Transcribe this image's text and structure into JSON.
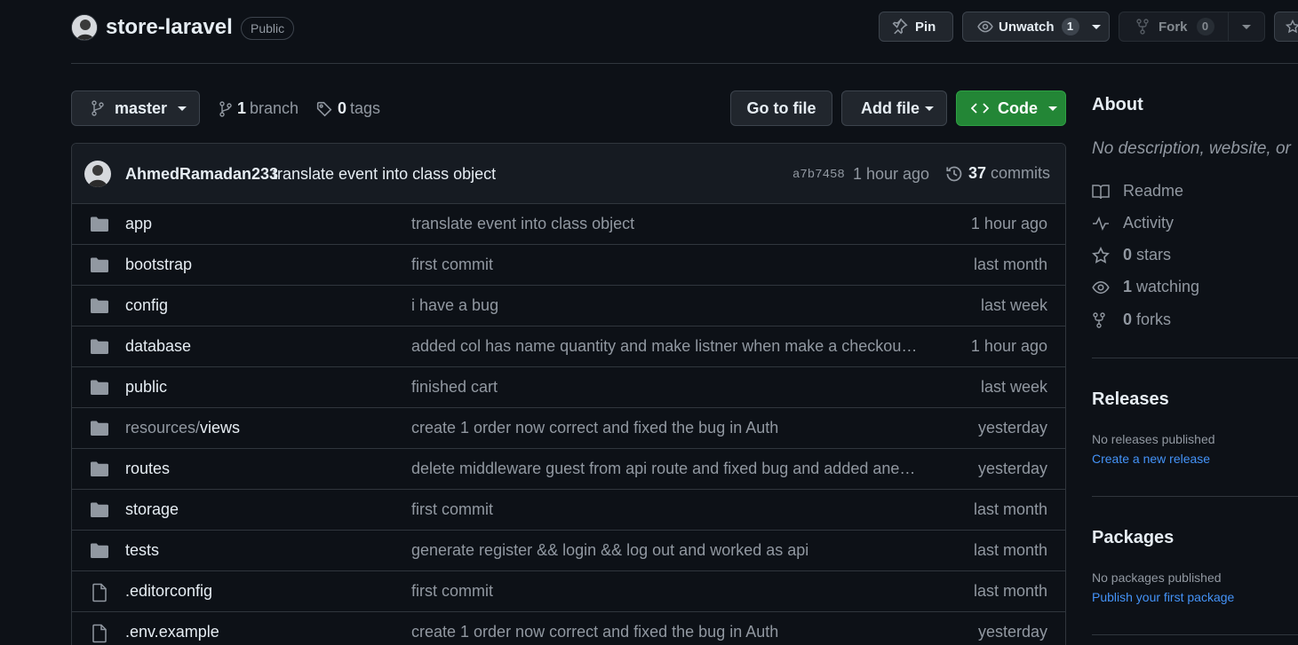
{
  "repo": {
    "name": "store-laravel",
    "visibility": "Public"
  },
  "header_actions": {
    "pin_label": "Pin",
    "unwatch_label": "Unwatch",
    "unwatch_count": "1",
    "fork_label": "Fork",
    "fork_count": "0"
  },
  "branch_bar": {
    "branch_name": "master",
    "branch_count": "1",
    "branch_label": "branch",
    "tag_count": "0",
    "tag_label": "tags",
    "go_to_file": "Go to file",
    "add_file": "Add file",
    "code": "Code"
  },
  "latest_commit": {
    "author": "AhmedRamadan233",
    "message": "translate event into class object",
    "sha": "a7b7458",
    "time": "1 hour ago",
    "commit_count": "37",
    "commit_label": "commits"
  },
  "files": [
    {
      "type": "folder",
      "name": "app",
      "prefix": "",
      "message": "translate event into class object",
      "time": "1 hour ago"
    },
    {
      "type": "folder",
      "name": "bootstrap",
      "prefix": "",
      "message": "first commit",
      "time": "last month"
    },
    {
      "type": "folder",
      "name": "config",
      "prefix": "",
      "message": "i have a bug",
      "time": "last week"
    },
    {
      "type": "folder",
      "name": "database",
      "prefix": "",
      "message": "added col has name quantity and make listner when make a checkout to…",
      "time": "1 hour ago"
    },
    {
      "type": "folder",
      "name": "public",
      "prefix": "",
      "message": "finished cart",
      "time": "last week"
    },
    {
      "type": "folder",
      "name": "views",
      "prefix": "resources/",
      "message": "create 1 order now correct and fixed the bug in Auth",
      "time": "yesterday"
    },
    {
      "type": "folder",
      "name": "routes",
      "prefix": "",
      "message": "delete middleware guest from api route and fixed bug and added anew …",
      "time": "yesterday"
    },
    {
      "type": "folder",
      "name": "storage",
      "prefix": "",
      "message": "first commit",
      "time": "last month"
    },
    {
      "type": "folder",
      "name": "tests",
      "prefix": "",
      "message": "generate register && login && log out and worked as api",
      "time": "last month"
    },
    {
      "type": "file",
      "name": ".editorconfig",
      "prefix": "",
      "message": "first commit",
      "time": "last month"
    },
    {
      "type": "file",
      "name": ".env.example",
      "prefix": "",
      "message": "create 1 order now correct and fixed the bug in Auth",
      "time": "yesterday"
    }
  ],
  "about": {
    "title": "About",
    "description": "No description, website, or",
    "readme": "Readme",
    "activity": "Activity",
    "stars_count": "0",
    "stars_label": "stars",
    "watching_count": "1",
    "watching_label": "watching",
    "forks_count": "0",
    "forks_label": "forks"
  },
  "releases": {
    "title": "Releases",
    "none_text": "No releases published",
    "create_link": "Create a new release"
  },
  "packages": {
    "title": "Packages",
    "none_text": "No packages published",
    "publish_link": "Publish your first package"
  },
  "colors": {
    "background": "#0d1117",
    "code_button": "#238636",
    "link": "#4493f8",
    "muted": "#9198a1"
  },
  "icons": {
    "folder": "folder-icon",
    "file": "file-icon"
  }
}
